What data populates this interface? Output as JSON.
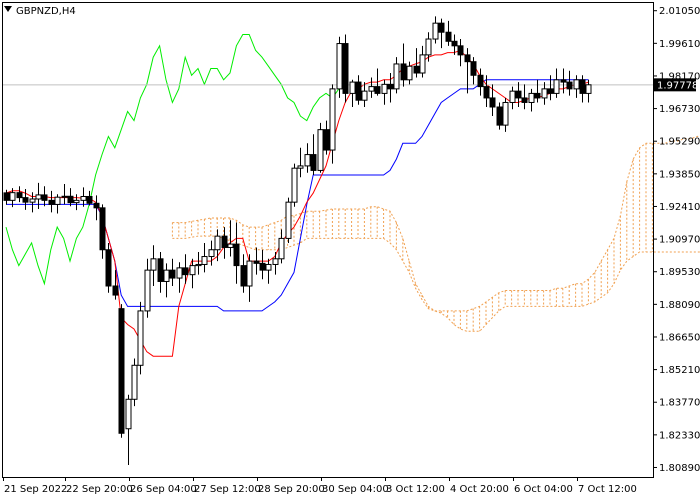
{
  "chart_data": {
    "type": "candlestick",
    "title": "GBPNZD,H4",
    "y_ticks": [
      "2.01050",
      "1.99610",
      "1.98170",
      "1.96730",
      "1.95290",
      "1.93850",
      "1.92410",
      "1.90970",
      "1.89530",
      "1.88090",
      "1.86650",
      "1.85210",
      "1.83770",
      "1.82330",
      "1.80890"
    ],
    "x_ticks": [
      "21 Sep 2022",
      "22 Sep 20:00",
      "26 Sep 04:00",
      "27 Sep 12:00",
      "28 Sep 20:00",
      "30 Sep 04:00",
      "3 Oct 12:00",
      "4 Oct 20:00",
      "6 Oct 04:00",
      "7 Oct 12:00"
    ],
    "ylim": [
      1.8047,
      2.0139
    ],
    "current_price": 1.97778,
    "current_price_label": "1.97778",
    "colors": {
      "tenkan": "#ff0000",
      "kijun": "#0000ff",
      "chikou": "#00ee00",
      "cloud": "#f0a050",
      "price_line": "#c0c0c0"
    },
    "candles": [
      [
        1.9301,
        1.9315,
        1.9249,
        1.9268
      ],
      [
        1.9268,
        1.9322,
        1.9238,
        1.9302
      ],
      [
        1.9302,
        1.933,
        1.926,
        1.928
      ],
      [
        1.928,
        1.9318,
        1.9226,
        1.926
      ],
      [
        1.926,
        1.9304,
        1.9215,
        1.9274
      ],
      [
        1.9274,
        1.9345,
        1.923,
        1.9292
      ],
      [
        1.9292,
        1.933,
        1.9242,
        1.9268
      ],
      [
        1.9268,
        1.931,
        1.9215,
        1.925
      ],
      [
        1.925,
        1.9295,
        1.921,
        1.9282
      ],
      [
        1.9282,
        1.934,
        1.925,
        1.9286
      ],
      [
        1.9286,
        1.9322,
        1.9242,
        1.9258
      ],
      [
        1.9258,
        1.9295,
        1.9225,
        1.9268
      ],
      [
        1.9268,
        1.9325,
        1.924,
        1.9285
      ],
      [
        1.9285,
        1.931,
        1.9245,
        1.9255
      ],
      [
        1.9255,
        1.929,
        1.918,
        1.9235
      ],
      [
        1.9235,
        1.925,
        1.901,
        1.905
      ],
      [
        1.905,
        1.908,
        1.886,
        1.889
      ],
      [
        1.889,
        1.896,
        1.883,
        1.885
      ],
      [
        1.879,
        1.881,
        1.822,
        1.824
      ],
      [
        1.826,
        1.841,
        1.81,
        1.839
      ],
      [
        1.839,
        1.857,
        1.836,
        1.854
      ],
      [
        1.854,
        1.882,
        1.85,
        1.878
      ],
      [
        1.878,
        1.901,
        1.875,
        1.896
      ],
      [
        1.896,
        1.907,
        1.889,
        1.901
      ],
      [
        1.901,
        1.904,
        1.886,
        1.891
      ],
      [
        1.891,
        1.899,
        1.884,
        1.896
      ],
      [
        1.896,
        1.901,
        1.889,
        1.8925
      ],
      [
        1.8925,
        1.8995,
        1.886,
        1.897
      ],
      [
        1.897,
        1.903,
        1.89,
        1.894
      ],
      [
        1.894,
        1.901,
        1.888,
        1.898
      ],
      [
        1.898,
        1.904,
        1.894,
        1.8985
      ],
      [
        1.8985,
        1.908,
        1.895,
        1.902
      ],
      [
        1.902,
        1.909,
        1.898,
        1.905
      ],
      [
        1.905,
        1.914,
        1.9,
        1.911
      ],
      [
        1.911,
        1.915,
        1.901,
        1.906
      ],
      [
        1.906,
        1.918,
        1.902,
        1.9075
      ],
      [
        1.9075,
        1.917,
        1.89,
        1.898
      ],
      [
        1.898,
        1.903,
        1.886,
        1.889
      ],
      [
        1.889,
        1.903,
        1.882,
        1.9
      ],
      [
        1.9,
        1.906,
        1.894,
        1.899
      ],
      [
        1.899,
        1.905,
        1.892,
        1.896
      ],
      [
        1.896,
        1.901,
        1.89,
        1.8985
      ],
      [
        1.8985,
        1.904,
        1.894,
        1.901
      ],
      [
        1.901,
        1.914,
        1.899,
        1.91
      ],
      [
        1.91,
        1.928,
        1.908,
        1.926
      ],
      [
        1.926,
        1.943,
        1.924,
        1.941
      ],
      [
        1.941,
        1.95,
        1.937,
        1.942
      ],
      [
        1.942,
        1.952,
        1.939,
        1.947
      ],
      [
        1.947,
        1.956,
        1.938,
        1.94
      ],
      [
        1.94,
        1.961,
        1.939,
        1.958
      ],
      [
        1.958,
        1.962,
        1.947,
        1.949
      ],
      [
        1.949,
        1.978,
        1.943,
        1.976
      ],
      [
        1.976,
        1.999,
        1.972,
        1.996
      ],
      [
        1.996,
        2.0,
        1.97,
        1.974
      ],
      [
        1.974,
        1.98,
        1.968,
        1.979
      ],
      [
        1.979,
        1.982,
        1.969,
        1.971
      ],
      [
        1.971,
        1.979,
        1.968,
        1.975
      ],
      [
        1.975,
        1.981,
        1.972,
        1.977
      ],
      [
        1.977,
        1.985,
        1.973,
        1.974
      ],
      [
        1.974,
        1.98,
        1.969,
        1.978
      ],
      [
        1.978,
        1.983,
        1.97,
        1.976
      ],
      [
        1.976,
        1.99,
        1.974,
        1.987
      ],
      [
        1.987,
        1.996,
        1.977,
        1.98
      ],
      [
        1.98,
        1.988,
        1.978,
        1.986
      ],
      [
        1.986,
        1.994,
        1.981,
        1.983
      ],
      [
        1.983,
        1.995,
        1.981,
        1.991
      ],
      [
        1.991,
        2.001,
        1.988,
        1.998
      ],
      [
        1.998,
        2.008,
        1.996,
        2.005
      ],
      [
        2.005,
        2.007,
        1.994,
        2.001
      ],
      [
        2.001,
        2.006,
        1.995,
        1.997
      ],
      [
        1.997,
        2.0,
        1.991,
        1.995
      ],
      [
        1.995,
        1.998,
        1.986,
        1.991
      ],
      [
        1.991,
        1.994,
        1.974,
        1.988
      ],
      [
        1.988,
        1.99,
        1.978,
        1.982
      ],
      [
        1.982,
        1.985,
        1.973,
        1.977
      ],
      [
        1.977,
        1.982,
        1.968,
        1.972
      ],
      [
        1.972,
        1.978,
        1.964,
        1.968
      ],
      [
        1.968,
        1.97,
        1.958,
        1.96
      ],
      [
        1.96,
        1.972,
        1.957,
        1.97
      ],
      [
        1.97,
        1.977,
        1.967,
        1.975
      ],
      [
        1.975,
        1.979,
        1.968,
        1.972
      ],
      [
        1.972,
        1.978,
        1.967,
        1.97
      ],
      [
        1.97,
        1.976,
        1.966,
        1.974
      ],
      [
        1.974,
        1.98,
        1.97,
        1.972
      ],
      [
        1.972,
        1.979,
        1.969,
        1.976
      ],
      [
        1.976,
        1.982,
        1.971,
        1.974
      ],
      [
        1.974,
        1.985,
        1.972,
        1.98
      ],
      [
        1.98,
        1.985,
        1.974,
        1.979
      ],
      [
        1.979,
        1.984,
        1.973,
        1.976
      ],
      [
        1.976,
        1.982,
        1.972,
        1.98
      ],
      [
        1.98,
        1.982,
        1.97,
        1.974
      ],
      [
        1.974,
        1.98,
        1.97,
        1.9778
      ]
    ],
    "tenkan": [
      1.93,
      1.931,
      1.931,
      1.93,
      1.9285,
      1.9285,
      1.9285,
      1.928,
      1.928,
      1.928,
      1.928,
      1.928,
      1.9278,
      1.9278,
      1.926,
      1.92,
      1.91,
      1.9,
      1.875,
      1.872,
      1.87,
      1.865,
      1.86,
      1.858,
      1.858,
      1.858,
      1.858,
      1.88,
      1.89,
      1.9,
      1.9,
      1.9,
      1.9,
      1.902,
      1.906,
      1.908,
      1.91,
      1.91,
      1.9,
      1.9,
      1.9,
      1.9,
      1.902,
      1.908,
      1.912,
      1.915,
      1.92,
      1.926,
      1.93,
      1.936,
      1.942,
      1.952,
      1.962,
      1.97,
      1.975,
      1.976,
      1.978,
      1.979,
      1.979,
      1.98,
      1.98,
      1.982,
      1.985,
      1.986,
      1.987,
      1.988,
      1.99,
      1.991,
      1.991,
      1.992,
      1.992,
      1.993,
      1.99,
      1.987,
      1.982,
      1.978,
      1.976,
      1.974,
      1.972,
      1.97,
      1.97,
      1.971,
      1.972,
      1.972,
      1.973,
      1.974,
      1.976,
      1.976,
      1.977,
      1.978,
      1.978,
      1.979
    ],
    "kijun": [
      1.925,
      1.925,
      1.925,
      1.925,
      1.925,
      1.925,
      1.925,
      1.925,
      1.925,
      1.925,
      1.925,
      1.925,
      1.925,
      1.925,
      1.925,
      1.92,
      1.91,
      1.9,
      1.885,
      1.88,
      1.88,
      1.88,
      1.88,
      1.88,
      1.88,
      1.88,
      1.88,
      1.88,
      1.88,
      1.88,
      1.88,
      1.88,
      1.88,
      1.88,
      1.878,
      1.878,
      1.878,
      1.878,
      1.878,
      1.878,
      1.878,
      1.88,
      1.882,
      1.885,
      1.89,
      1.895,
      1.91,
      1.925,
      1.938,
      1.938,
      1.938,
      1.938,
      1.938,
      1.938,
      1.938,
      1.938,
      1.938,
      1.938,
      1.938,
      1.938,
      1.94,
      1.945,
      1.952,
      1.952,
      1.952,
      1.955,
      1.96,
      1.965,
      1.97,
      1.972,
      1.974,
      1.976,
      1.976,
      1.976,
      1.978,
      1.98,
      1.98,
      1.98,
      1.98,
      1.98,
      1.98,
      1.98,
      1.98,
      1.98,
      1.98,
      1.98,
      1.98,
      1.98,
      1.98,
      1.98,
      1.98,
      1.98
    ],
    "span_a": [
      1.917,
      1.917,
      1.917,
      1.9175,
      1.918,
      1.9185,
      1.919,
      1.919,
      1.919,
      1.919,
      1.918,
      1.916,
      1.915,
      1.915,
      1.915,
      1.916,
      1.917,
      1.918,
      1.92,
      1.92,
      1.921,
      1.922,
      1.922,
      1.922,
      1.9225,
      1.923,
      1.923,
      1.923,
      1.923,
      1.923,
      1.923,
      1.924,
      1.924,
      1.923,
      1.922,
      1.917,
      1.91,
      1.9,
      1.89,
      1.885,
      1.88,
      1.878,
      1.878,
      1.878,
      1.878,
      1.878,
      1.878,
      1.879,
      1.88,
      1.882,
      1.884,
      1.886,
      1.887,
      1.887,
      1.887,
      1.887,
      1.887,
      1.887,
      1.887,
      1.887,
      1.888,
      1.888,
      1.889,
      1.89,
      1.89,
      1.892,
      1.895,
      1.9,
      1.905,
      1.91,
      1.92,
      1.935,
      1.945,
      1.95,
      1.952,
      1.952,
      1.952,
      1.952,
      1.953,
      1.953,
      1.954,
      1.954,
      1.955,
      1.956,
      1.957,
      1.958,
      1.959,
      1.96,
      1.961,
      1.962,
      1.963,
      1.964
    ],
    "span_b": [
      1.91,
      1.91,
      1.91,
      1.9105,
      1.911,
      1.911,
      1.911,
      1.911,
      1.91,
      1.909,
      1.908,
      1.907,
      1.906,
      1.905,
      1.905,
      1.905,
      1.905,
      1.905,
      1.906,
      1.907,
      1.908,
      1.91,
      1.91,
      1.91,
      1.91,
      1.91,
      1.91,
      1.91,
      1.91,
      1.91,
      1.91,
      1.91,
      1.91,
      1.91,
      1.908,
      1.905,
      1.9,
      1.895,
      1.888,
      1.883,
      1.879,
      1.878,
      1.877,
      1.875,
      1.872,
      1.87,
      1.869,
      1.869,
      1.869,
      1.872,
      1.875,
      1.878,
      1.88,
      1.88,
      1.88,
      1.88,
      1.88,
      1.88,
      1.88,
      1.88,
      1.88,
      1.88,
      1.88,
      1.88,
      1.88,
      1.881,
      1.882,
      1.884,
      1.886,
      1.89,
      1.896,
      1.9,
      1.902,
      1.904,
      1.904,
      1.904,
      1.904,
      1.904,
      1.904,
      1.904,
      1.904,
      1.904,
      1.904,
      1.904,
      1.904,
      1.904,
      1.904,
      1.904,
      1.904,
      1.904,
      1.904,
      1.904
    ],
    "chikou": [
      1.915,
      1.905,
      1.898,
      1.903,
      1.908,
      1.898,
      1.89,
      1.905,
      1.915,
      1.91,
      1.9,
      1.91,
      1.915,
      1.925,
      1.938,
      1.947,
      1.955,
      1.95,
      1.958,
      1.966,
      1.962,
      1.972,
      1.978,
      1.99,
      1.995,
      1.98,
      1.97,
      1.976,
      1.99,
      1.982,
      1.985,
      1.978,
      1.985,
      1.985,
      1.98,
      1.983,
      1.995,
      2.0,
      2.0,
      1.993,
      1.99,
      1.986,
      1.982,
      1.978,
      1.972,
      1.97,
      1.964,
      1.962,
      1.968,
      1.972,
      1.974,
      1.972,
      1.976
    ]
  }
}
